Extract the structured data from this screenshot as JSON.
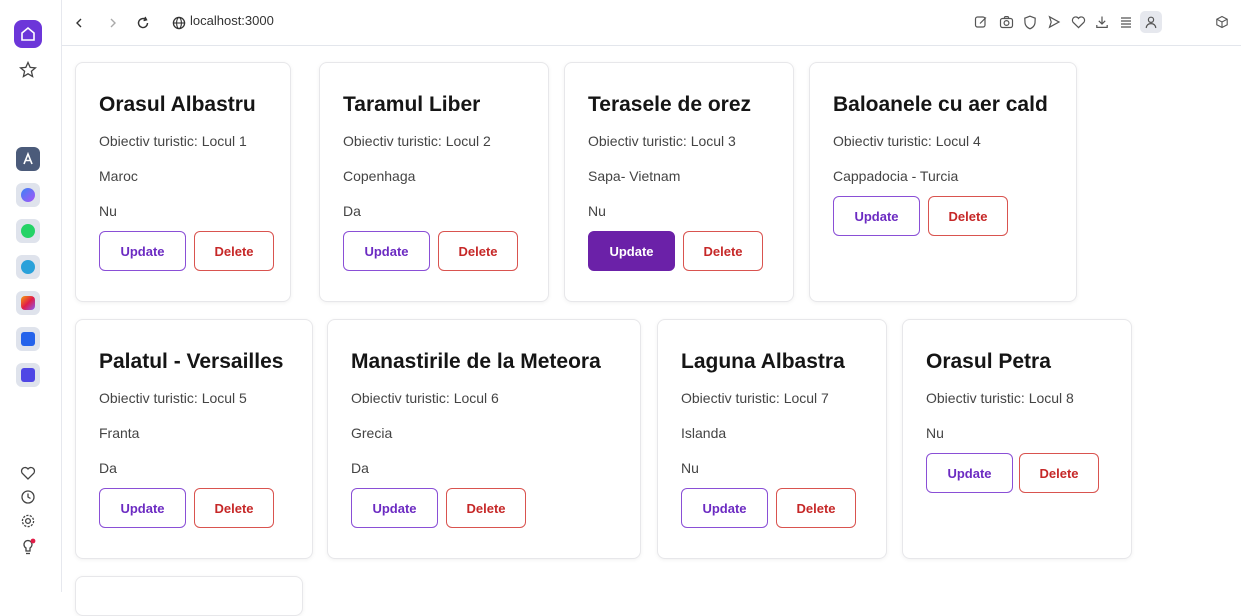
{
  "browser": {
    "url": "localhost:3000"
  },
  "labels": {
    "update": "Update",
    "delete": "Delete"
  },
  "cards": [
    {
      "title": "Orasul Albastru",
      "objective": "Obiectiv turistic: Locul 1",
      "location": "Maroc",
      "answer": "Nu"
    },
    {
      "title": "Taramul Liber",
      "objective": "Obiectiv turistic: Locul 2",
      "location": "Copenhaga",
      "answer": "Da"
    },
    {
      "title": "Terasele de orez",
      "objective": "Obiectiv turistic: Locul 3",
      "location": "Sapa- Vietnam",
      "answer": "Nu"
    },
    {
      "title": "Baloanele cu aer cald",
      "objective": "Obiectiv turistic: Locul 4",
      "location": "Cappadocia - Turcia",
      "answer": ""
    },
    {
      "title": "Palatul - Versailles",
      "objective": "Obiectiv turistic: Locul 5",
      "location": "Franta",
      "answer": "Da"
    },
    {
      "title": "Manastirile de la Meteora",
      "objective": "Obiectiv turistic: Locul 6",
      "location": "Grecia",
      "answer": "Da"
    },
    {
      "title": "Laguna Albastra",
      "objective": "Obiectiv turistic: Locul 7",
      "location": "Islanda",
      "answer": "Nu"
    },
    {
      "title": "Orasul Petra",
      "objective": "Obiectiv turistic: Locul 8",
      "location": "Nu",
      "answer": ""
    }
  ],
  "sidebar": {
    "apps": [
      "app-store-icon",
      "messenger-icon",
      "whatsapp-icon",
      "telegram-icon",
      "instagram-icon",
      "music-icon",
      "player-icon"
    ],
    "bottom": [
      "heart-icon",
      "history-icon",
      "settings-icon",
      "tips-icon"
    ]
  },
  "colors": {
    "accent": "#6b21a8",
    "delete": "#c62828"
  }
}
